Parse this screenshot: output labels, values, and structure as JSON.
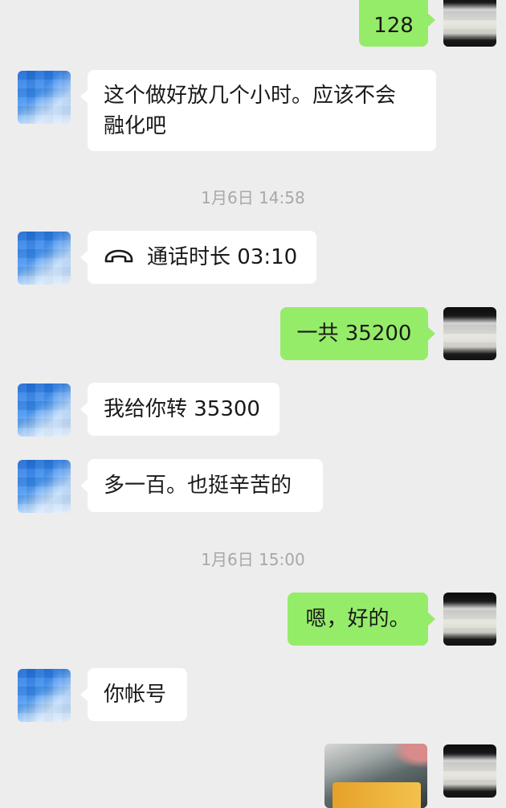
{
  "messages": [
    {
      "id": "m1",
      "dir": "out",
      "text": "128"
    },
    {
      "id": "m2",
      "dir": "in",
      "line1": "这个做好放几个小时。应该不会",
      "line2": "融化吧"
    },
    {
      "id": "t1",
      "type": "time",
      "text": "1月6日 14:58"
    },
    {
      "id": "m3",
      "dir": "in",
      "type": "call",
      "text": "通话时长 03:10",
      "icon": "phone-hangup-icon"
    },
    {
      "id": "m4",
      "dir": "out",
      "text": "一共 35200"
    },
    {
      "id": "m5",
      "dir": "in",
      "text": "我给你转 35300"
    },
    {
      "id": "m6",
      "dir": "in",
      "text": "多一百。也挺辛苦的"
    },
    {
      "id": "t2",
      "type": "time",
      "text": "1月6日 15:00"
    },
    {
      "id": "m7",
      "dir": "out",
      "text": "嗯，好的。"
    },
    {
      "id": "m8",
      "dir": "in",
      "text": "你帐号"
    },
    {
      "id": "m9",
      "dir": "out",
      "type": "image"
    }
  ],
  "colors": {
    "background": "#ededed",
    "outgoing_bubble": "#95ec69",
    "incoming_bubble": "#ffffff",
    "timestamp_text": "#a8a8a8"
  }
}
